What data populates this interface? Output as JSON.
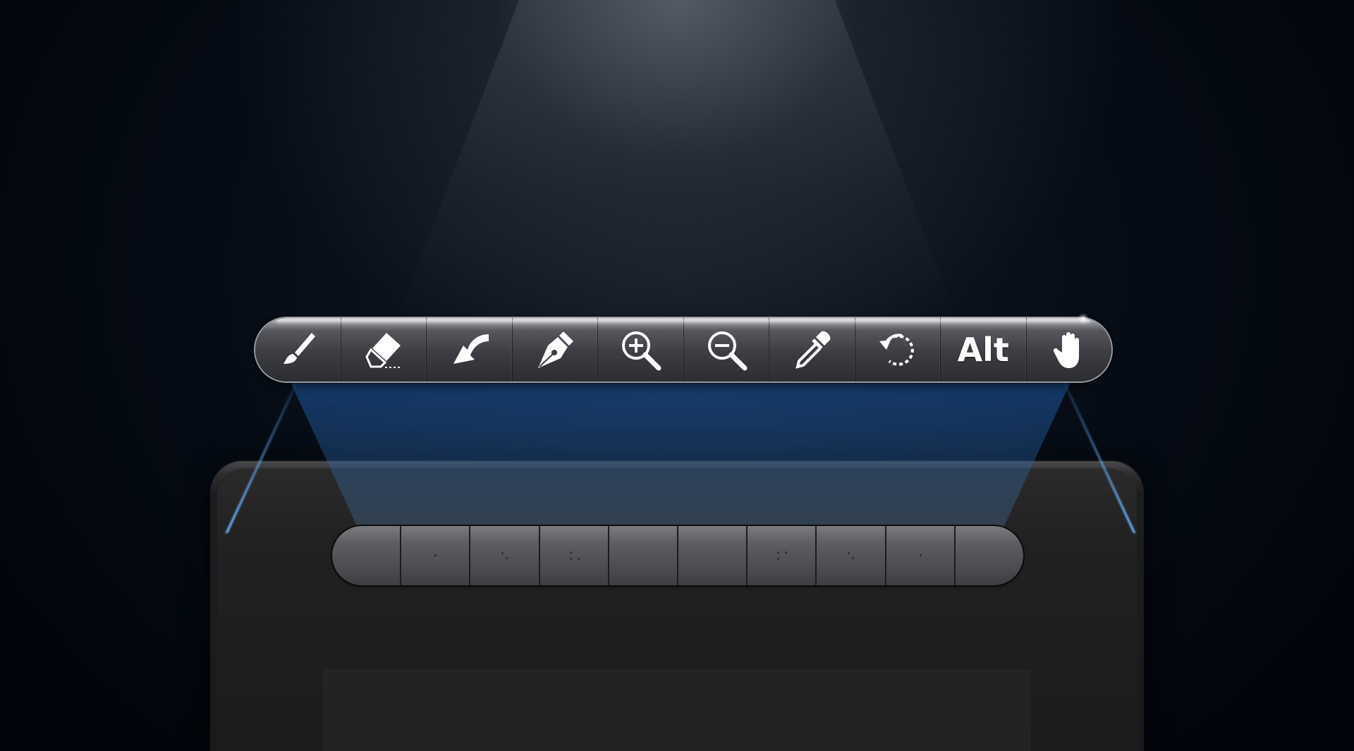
{
  "toolbar": {
    "buttons": [
      {
        "icon": "paintbrush-icon"
      },
      {
        "icon": "eraser-icon"
      },
      {
        "icon": "undo-arrow-icon"
      },
      {
        "icon": "pen-nib-icon"
      },
      {
        "icon": "zoom-in-icon"
      },
      {
        "icon": "zoom-out-icon"
      },
      {
        "icon": "eyedropper-icon"
      },
      {
        "icon": "rotate-icon"
      },
      {
        "icon": "alt-key",
        "label": "Alt"
      },
      {
        "icon": "hand-pan-icon"
      }
    ]
  },
  "express_keys": {
    "count": 10
  },
  "colors": {
    "background": "#03080f",
    "projection_blue": "#1e5aaa",
    "toolbar_dark": "#2b2d31",
    "icon": "#ffffff",
    "tablet": "#1b1b1c"
  }
}
